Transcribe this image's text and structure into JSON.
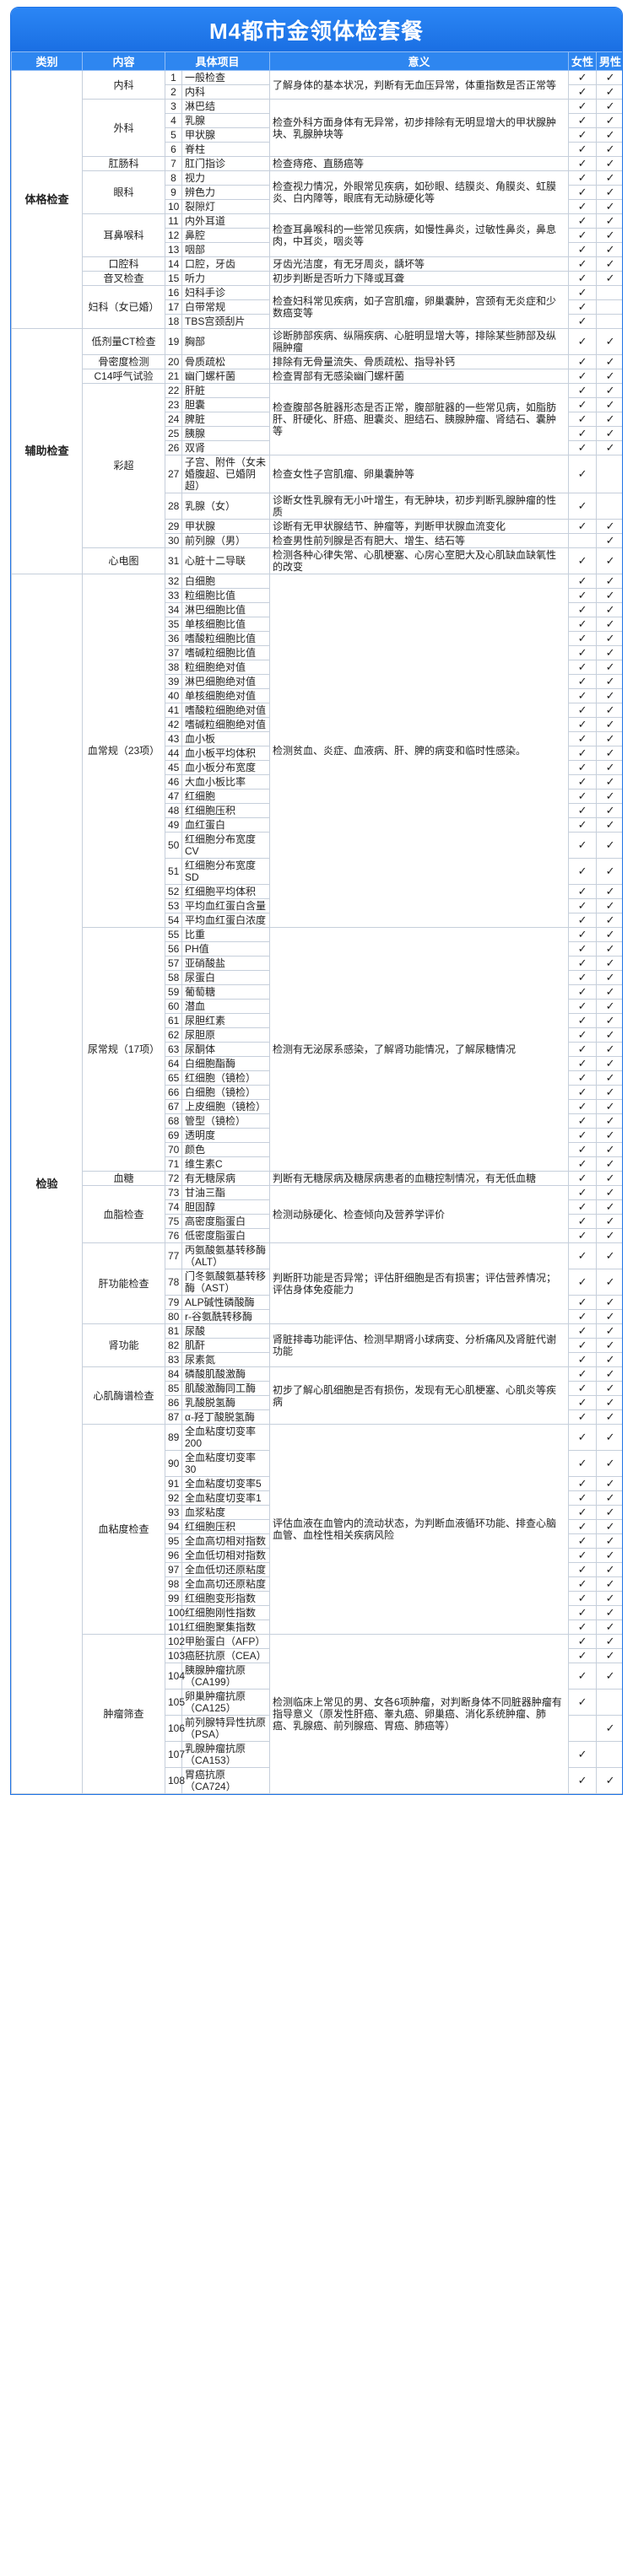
{
  "title": "M4都市金领体检套餐",
  "headers": [
    "类别",
    "内容",
    "具体项目",
    "意义",
    "女性",
    "男性"
  ],
  "check_mark": "✓",
  "sections": [
    {
      "category": "体格检查",
      "subs": [
        {
          "name": "内科",
          "desc": "了解身体的基本状况，判断有无血压异常，体重指数是否正常等",
          "items": [
            {
              "n": 1,
              "name": "一般检查",
              "f": 1,
              "m": 1
            },
            {
              "n": 2,
              "name": "内科",
              "f": 1,
              "m": 1
            }
          ]
        },
        {
          "name": "外科",
          "desc": "检查外科方面身体有无异常，初步排除有无明显增大的甲状腺肿块、乳腺肿块等",
          "items": [
            {
              "n": 3,
              "name": "淋巴结",
              "f": 1,
              "m": 1
            },
            {
              "n": 4,
              "name": "乳腺",
              "f": 1,
              "m": 1
            },
            {
              "n": 5,
              "name": "甲状腺",
              "f": 1,
              "m": 1
            },
            {
              "n": 6,
              "name": "脊柱",
              "f": 1,
              "m": 1
            }
          ]
        },
        {
          "name": "肛肠科",
          "desc": "检查痔疮、直肠癌等",
          "items": [
            {
              "n": 7,
              "name": "肛门指诊",
              "f": 1,
              "m": 1
            }
          ]
        },
        {
          "name": "眼科",
          "desc": "检查视力情况，外眼常见疾病，如砂眼、结膜炎、角膜炎、虹膜炎、白内障等，眼底有无动脉硬化等",
          "items": [
            {
              "n": 8,
              "name": "视力",
              "f": 1,
              "m": 1
            },
            {
              "n": 9,
              "name": "辨色力",
              "f": 1,
              "m": 1
            },
            {
              "n": 10,
              "name": "裂隙灯",
              "f": 1,
              "m": 1
            }
          ]
        },
        {
          "name": "耳鼻喉科",
          "desc": "检查耳鼻喉科的一些常见疾病，如慢性鼻炎，过敏性鼻炎，鼻息肉，中耳炎，咽炎等",
          "items": [
            {
              "n": 11,
              "name": "内外耳道",
              "f": 1,
              "m": 1
            },
            {
              "n": 12,
              "name": "鼻腔",
              "f": 1,
              "m": 1
            },
            {
              "n": 13,
              "name": "咽部",
              "f": 1,
              "m": 1
            }
          ]
        },
        {
          "name": "口腔科",
          "desc": "牙齿光洁度，有无牙周炎，龋坏等",
          "items": [
            {
              "n": 14,
              "name": "口腔，牙齿",
              "f": 1,
              "m": 1
            }
          ]
        },
        {
          "name": "音叉检查",
          "desc": "初步判断是否听力下降或耳聋",
          "items": [
            {
              "n": 15,
              "name": "听力",
              "f": 1,
              "m": 1
            }
          ]
        },
        {
          "name": "妇科（女已婚）",
          "desc": "检查妇科常见疾病，如子宫肌瘤，卵巢囊肿，宫颈有无炎症和少数癌变等",
          "items": [
            {
              "n": 16,
              "name": "妇科手诊",
              "f": 1,
              "m": 0
            },
            {
              "n": 17,
              "name": "白带常规",
              "f": 1,
              "m": 0
            },
            {
              "n": 18,
              "name": "TBS宫颈刮片",
              "f": 1,
              "m": 0
            }
          ]
        }
      ]
    },
    {
      "category": "辅助检查",
      "subs": [
        {
          "name": "低剂量CT检查",
          "desc": "诊断肺部疾病、纵隔疾病、心脏明显增大等，排除某些肺部及纵隔肿瘤",
          "items": [
            {
              "n": 19,
              "name": "胸部",
              "f": 1,
              "m": 1
            }
          ]
        },
        {
          "name": "骨密度检测",
          "desc": "排除有无骨量流失、骨质疏松、指导补钙",
          "items": [
            {
              "n": 20,
              "name": "骨质疏松",
              "f": 1,
              "m": 1
            }
          ]
        },
        {
          "name": "C14呼气试验",
          "desc": "检查胃部有无感染幽门螺杆菌",
          "items": [
            {
              "n": 21,
              "name": "幽门螺杆菌",
              "f": 1,
              "m": 1
            }
          ]
        },
        {
          "name": "彩超",
          "groups": [
            {
              "desc": "检查腹部各脏器形态是否正常，腹部脏器的一些常见病，如脂肪肝、肝硬化、肝癌、胆囊炎、胆结石、胰腺肿瘤、肾结石、囊肿等",
              "items": [
                {
                  "n": 22,
                  "name": "肝脏",
                  "f": 1,
                  "m": 1
                },
                {
                  "n": 23,
                  "name": "胆囊",
                  "f": 1,
                  "m": 1
                },
                {
                  "n": 24,
                  "name": "脾脏",
                  "f": 1,
                  "m": 1
                },
                {
                  "n": 25,
                  "name": "胰腺",
                  "f": 1,
                  "m": 1
                },
                {
                  "n": 26,
                  "name": "双肾",
                  "f": 1,
                  "m": 1
                }
              ]
            },
            {
              "desc": "检查女性子宫肌瘤、卵巢囊肿等",
              "items": [
                {
                  "n": 27,
                  "name": "子宫、附件（女未婚腹超、已婚阴超）",
                  "f": 1,
                  "m": 0
                }
              ]
            },
            {
              "desc": "诊断女性乳腺有无小叶增生，有无肿块，初步判断乳腺肿瘤的性质",
              "items": [
                {
                  "n": 28,
                  "name": "乳腺（女）",
                  "f": 1,
                  "m": 0
                }
              ]
            },
            {
              "desc": "诊断有无甲状腺结节、肿瘤等，判断甲状腺血流变化",
              "items": [
                {
                  "n": 29,
                  "name": "甲状腺",
                  "f": 1,
                  "m": 1
                }
              ]
            },
            {
              "desc": "检查男性前列腺是否有肥大、增生、结石等",
              "items": [
                {
                  "n": 30,
                  "name": "前列腺（男）",
                  "f": 0,
                  "m": 1
                }
              ]
            }
          ]
        },
        {
          "name": "心电图",
          "desc": "检测各种心律失常、心肌梗塞、心房心室肥大及心肌缺血缺氧性的改变",
          "items": [
            {
              "n": 31,
              "name": "心脏十二导联",
              "f": 1,
              "m": 1
            }
          ]
        }
      ]
    },
    {
      "category": "检验",
      "subs": [
        {
          "name": "血常规（23项）",
          "desc": "检测贫血、炎症、血液病、肝、脾的病变和临时性感染。",
          "items": [
            {
              "n": 32,
              "name": "白细胞",
              "f": 1,
              "m": 1
            },
            {
              "n": 33,
              "name": "粒细胞比值",
              "f": 1,
              "m": 1
            },
            {
              "n": 34,
              "name": "淋巴细胞比值",
              "f": 1,
              "m": 1
            },
            {
              "n": 35,
              "name": "单核细胞比值",
              "f": 1,
              "m": 1
            },
            {
              "n": 36,
              "name": "嗜酸粒细胞比值",
              "f": 1,
              "m": 1
            },
            {
              "n": 37,
              "name": "嗜碱粒细胞比值",
              "f": 1,
              "m": 1
            },
            {
              "n": 38,
              "name": "粒细胞绝对值",
              "f": 1,
              "m": 1
            },
            {
              "n": 39,
              "name": "淋巴细胞绝对值",
              "f": 1,
              "m": 1
            },
            {
              "n": 40,
              "name": "单核细胞绝对值",
              "f": 1,
              "m": 1
            },
            {
              "n": 41,
              "name": "嗜酸粒细胞绝对值",
              "f": 1,
              "m": 1
            },
            {
              "n": 42,
              "name": "嗜碱粒细胞绝对值",
              "f": 1,
              "m": 1
            },
            {
              "n": 43,
              "name": "血小板",
              "f": 1,
              "m": 1
            },
            {
              "n": 44,
              "name": "血小板平均体积",
              "f": 1,
              "m": 1
            },
            {
              "n": 45,
              "name": "血小板分布宽度",
              "f": 1,
              "m": 1
            },
            {
              "n": 46,
              "name": "大血小板比率",
              "f": 1,
              "m": 1
            },
            {
              "n": 47,
              "name": "红细胞",
              "f": 1,
              "m": 1
            },
            {
              "n": 48,
              "name": "红细胞压积",
              "f": 1,
              "m": 1
            },
            {
              "n": 49,
              "name": "血红蛋白",
              "f": 1,
              "m": 1
            },
            {
              "n": 50,
              "name": "红细胞分布宽度CV",
              "f": 1,
              "m": 1
            },
            {
              "n": 51,
              "name": "红细胞分布宽度SD",
              "f": 1,
              "m": 1
            },
            {
              "n": 52,
              "name": "红细胞平均体积",
              "f": 1,
              "m": 1
            },
            {
              "n": 53,
              "name": "平均血红蛋白含量",
              "f": 1,
              "m": 1
            },
            {
              "n": 54,
              "name": "平均血红蛋白浓度",
              "f": 1,
              "m": 1
            }
          ]
        },
        {
          "name": "尿常规（17项）",
          "desc": "检测有无泌尿系感染，了解肾功能情况，了解尿糖情况",
          "items": [
            {
              "n": 55,
              "name": "比重",
              "f": 1,
              "m": 1
            },
            {
              "n": 56,
              "name": "PH值",
              "f": 1,
              "m": 1
            },
            {
              "n": 57,
              "name": "亚硝酸盐",
              "f": 1,
              "m": 1
            },
            {
              "n": 58,
              "name": "尿蛋白",
              "f": 1,
              "m": 1
            },
            {
              "n": 59,
              "name": "葡萄糖",
              "f": 1,
              "m": 1
            },
            {
              "n": 60,
              "name": "潜血",
              "f": 1,
              "m": 1
            },
            {
              "n": 61,
              "name": "尿胆红素",
              "f": 1,
              "m": 1
            },
            {
              "n": 62,
              "name": "尿胆原",
              "f": 1,
              "m": 1
            },
            {
              "n": 63,
              "name": "尿酮体",
              "f": 1,
              "m": 1
            },
            {
              "n": 64,
              "name": "白细胞酯酶",
              "f": 1,
              "m": 1
            },
            {
              "n": 65,
              "name": "红细胞（镜检）",
              "f": 1,
              "m": 1
            },
            {
              "n": 66,
              "name": "白细胞（镜检）",
              "f": 1,
              "m": 1
            },
            {
              "n": 67,
              "name": "上皮细胞（镜检）",
              "f": 1,
              "m": 1
            },
            {
              "n": 68,
              "name": "管型（镜检）",
              "f": 1,
              "m": 1
            },
            {
              "n": 69,
              "name": "透明度",
              "f": 1,
              "m": 1
            },
            {
              "n": 70,
              "name": "颜色",
              "f": 1,
              "m": 1
            },
            {
              "n": 71,
              "name": "维生素C",
              "f": 1,
              "m": 1
            }
          ]
        },
        {
          "name": "血糖",
          "desc": "判断有无糖尿病及糖尿病患者的血糖控制情况，有无低血糖",
          "items": [
            {
              "n": 72,
              "name": "有无糖尿病",
              "f": 1,
              "m": 1
            }
          ]
        },
        {
          "name": "血脂检查",
          "desc": "检测动脉硬化、检查倾向及营养学评价",
          "items": [
            {
              "n": 73,
              "name": "甘油三酯",
              "f": 1,
              "m": 1
            },
            {
              "n": 74,
              "name": "胆固醇",
              "f": 1,
              "m": 1
            },
            {
              "n": 75,
              "name": "高密度脂蛋白",
              "f": 1,
              "m": 1
            },
            {
              "n": 76,
              "name": "低密度脂蛋白",
              "f": 1,
              "m": 1
            }
          ]
        },
        {
          "name": "肝功能检查",
          "desc": "判断肝功能是否异常；评估肝细胞是否有损害；评估营养情况；评估身体免疫能力",
          "items": [
            {
              "n": 77,
              "name": "丙氨酸氨基转移酶（ALT）",
              "f": 1,
              "m": 1
            },
            {
              "n": 78,
              "name": "门冬氨酸氨基转移酶（AST）",
              "f": 1,
              "m": 1
            },
            {
              "n": 79,
              "name": "ALP碱性磷酸酶",
              "f": 1,
              "m": 1
            },
            {
              "n": 80,
              "name": "r-谷氨酰转移酶",
              "f": 1,
              "m": 1
            }
          ]
        },
        {
          "name": "肾功能",
          "desc": "肾脏排毒功能评估、检测早期肾小球病变、分析痛风及肾脏代谢功能",
          "items": [
            {
              "n": 81,
              "name": "尿酸",
              "f": 1,
              "m": 1
            },
            {
              "n": 82,
              "name": "肌酐",
              "f": 1,
              "m": 1
            },
            {
              "n": 83,
              "name": "尿素氮",
              "f": 1,
              "m": 1
            }
          ]
        },
        {
          "name": "心肌酶谱检查",
          "desc": "初步了解心肌细胞是否有损伤，发现有无心肌梗塞、心肌炎等疾病",
          "items": [
            {
              "n": 84,
              "name": "磷酸肌酸激酶",
              "f": 1,
              "m": 1
            },
            {
              "n": 85,
              "name": "肌酸激酶同工酶",
              "f": 1,
              "m": 1
            },
            {
              "n": 86,
              "name": "乳酸脱氢酶",
              "f": 1,
              "m": 1
            },
            {
              "n": 87,
              "name": "α-羟丁酸脱氢酶",
              "f": 1,
              "m": 1
            }
          ]
        },
        {
          "name": "血粘度检查",
          "desc": "评估血液在血管内的流动状态，为判断血液循环功能、排查心脑血管、血栓性相关疾病风险",
          "items": [
            {
              "n": 89,
              "name": "全血粘度切变率200",
              "f": 1,
              "m": 1
            },
            {
              "n": 90,
              "name": "全血粘度切变率30",
              "f": 1,
              "m": 1
            },
            {
              "n": 91,
              "name": "全血粘度切变率5",
              "f": 1,
              "m": 1
            },
            {
              "n": 92,
              "name": "全血粘度切变率1",
              "f": 1,
              "m": 1
            },
            {
              "n": 93,
              "name": "血浆粘度",
              "f": 1,
              "m": 1
            },
            {
              "n": 94,
              "name": "红细胞压积",
              "f": 1,
              "m": 1
            },
            {
              "n": 95,
              "name": "全血高切相对指数",
              "f": 1,
              "m": 1
            },
            {
              "n": 96,
              "name": "全血低切相对指数",
              "f": 1,
              "m": 1
            },
            {
              "n": 97,
              "name": "全血低切还原粘度",
              "f": 1,
              "m": 1
            },
            {
              "n": 98,
              "name": "全血高切还原粘度",
              "f": 1,
              "m": 1
            },
            {
              "n": 99,
              "name": "红细胞变形指数",
              "f": 1,
              "m": 1
            },
            {
              "n": 100,
              "name": "红细胞刚性指数",
              "f": 1,
              "m": 1
            },
            {
              "n": 101,
              "name": "红细胞聚集指数",
              "f": 1,
              "m": 1
            }
          ]
        },
        {
          "name": "肿瘤筛查",
          "desc": "检测临床上常见的男、女各6项肿瘤，对判断身体不同脏器肿瘤有指导意义（原发性肝癌、睾丸癌、卵巢癌、消化系统肿瘤、肺癌、乳腺癌、前列腺癌、胃癌、肺癌等）",
          "items": [
            {
              "n": 102,
              "name": "甲胎蛋白（AFP）",
              "f": 1,
              "m": 1
            },
            {
              "n": 103,
              "name": "癌胚抗原（CEA）",
              "f": 1,
              "m": 1
            },
            {
              "n": 104,
              "name": "胰腺肿瘤抗原（CA199）",
              "f": 1,
              "m": 1
            },
            {
              "n": 105,
              "name": "卵巢肿瘤抗原（CA125）",
              "f": 1,
              "m": 0
            },
            {
              "n": 106,
              "name": "前列腺特异性抗原（PSA）",
              "f": 0,
              "m": 1
            },
            {
              "n": 107,
              "name": "乳腺肿瘤抗原（CA153）",
              "f": 1,
              "m": 0
            },
            {
              "n": 108,
              "name": "胃癌抗原（CA724）",
              "f": 1,
              "m": 1
            }
          ]
        }
      ]
    }
  ]
}
